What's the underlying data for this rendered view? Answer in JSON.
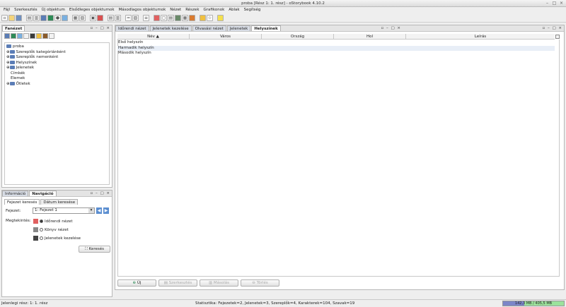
{
  "window": {
    "title": "proba [Rész 1: 1. rész] - oStorybook 4.10.2"
  },
  "menu": [
    "Fájl",
    "Szerkesztés",
    "Új objektum",
    "Elsődleges objektumok",
    "Másodlagos objektumok",
    "Nézet",
    "Részek",
    "Grafikonok",
    "Ablak",
    "Segítség"
  ],
  "toolbar": {
    "icons": [
      "new-file-icon",
      "open-icon",
      "save-icon",
      "document-icon",
      "copy-icon",
      "chapter-icon",
      "scene-icon",
      "person-icon",
      "location-icon",
      "tag-icon",
      "item-icon",
      "view-icon",
      "view2-icon",
      "memo-icon",
      "chrono-icon",
      "timeline-icon",
      "manage-icon",
      "chart-icon",
      "chart2-icon",
      "export-icon",
      "print-icon",
      "book-icon",
      "list-icon",
      "find-icon",
      "idea-icon",
      "star-icon",
      "bulb-icon"
    ]
  },
  "left_panel": {
    "tab": "Fanézet",
    "tree": {
      "root": "proba",
      "children": [
        "Szereplők kategóriánként",
        "Szereplők nemenként",
        "Helyszínek",
        "Jelenetek",
        "Címkék",
        "Elemek",
        "Ötletek"
      ]
    }
  },
  "nav_panel": {
    "tabs": [
      "Információ",
      "Navigáció"
    ],
    "subtabs": [
      "Fejezet keresés",
      "Dátum keresése"
    ],
    "chapter_label": "Fejezet:",
    "chapter_value": "1: Fejezet 1",
    "view_label": "Megtekintés:",
    "views": [
      "Időrendi nézet",
      "Könyv nézet",
      "Jelenetek kezelése"
    ],
    "search_button": "Keresés"
  },
  "main_panel": {
    "tabs": [
      "Időrendi nézet",
      "Jelenetek kezelése",
      "Olvasási nézet",
      "Jelenetek",
      "Helyszínek"
    ],
    "columns": [
      "Név ▲",
      "Város",
      "Ország",
      "Hol",
      "Leírás"
    ],
    "rows": [
      "Első helyszín",
      "Harmadik helyszín",
      "Második helyszín"
    ],
    "buttons": [
      "Új",
      "Szerkesztés",
      "Másolás",
      "Törlés"
    ]
  },
  "status": {
    "left": "Jelenlegi rész: 1: 1. rész",
    "stats": "Statisztika: Fejezetek=2, Jelenetek=3, Szereplők=4, Karakterek=104, Szavak=19",
    "memory": "142,3 MB / 405,5 MB",
    "memory_fraction": 0.35
  }
}
